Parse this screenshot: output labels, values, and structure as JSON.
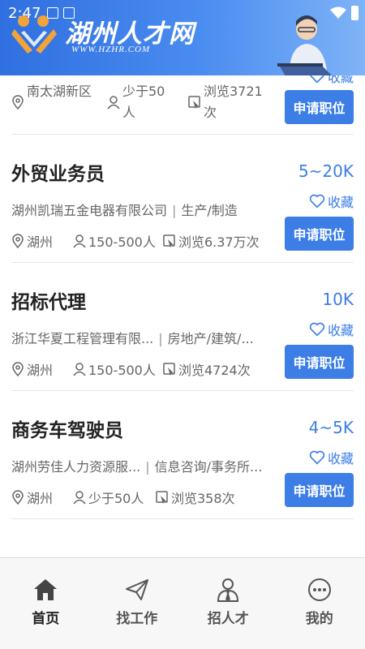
{
  "status_bar": {
    "time": "2:47"
  },
  "brand": {
    "title": "湖州人才网",
    "url": "WWW.HZHR.COM"
  },
  "jobs": [
    {
      "title": "",
      "salary": "",
      "favorite_label": "收藏",
      "company": "",
      "industry": "",
      "location": "南太湖新区",
      "company_size": "少于50人",
      "views": "浏览3721次",
      "apply_label": "申请职位"
    },
    {
      "title": "外贸业务员",
      "salary": "5~20K",
      "favorite_label": "收藏",
      "company": "湖州凯瑞五金电器有限公司",
      "industry": "生产/制造",
      "location": "湖州",
      "company_size": "150-500人",
      "views": "浏览6.37万次",
      "apply_label": "申请职位"
    },
    {
      "title": "招标代理",
      "salary": "10K",
      "favorite_label": "收藏",
      "company": "浙江华夏工程管理有限...",
      "industry": "房地产/建筑/...",
      "location": "湖州",
      "company_size": "150-500人",
      "views": "浏览4724次",
      "apply_label": "申请职位"
    },
    {
      "title": "商务车驾驶员",
      "salary": "4~5K",
      "favorite_label": "收藏",
      "company": "湖州劳佳人力资源服...",
      "industry": "信息咨询/事务所...",
      "location": "湖州",
      "company_size": "少于50人",
      "views": "浏览358次",
      "apply_label": "申请职位"
    }
  ],
  "nav": [
    {
      "label": "首页",
      "icon": "home-icon",
      "active": true
    },
    {
      "label": "找工作",
      "icon": "paper-plane-icon",
      "active": false
    },
    {
      "label": "招人才",
      "icon": "person-tie-icon",
      "active": false
    },
    {
      "label": "我的",
      "icon": "chat-dots-icon",
      "active": false
    }
  ],
  "colors": {
    "accent": "#3c7ee6",
    "header_start": "#2f6fe0",
    "header_end": "#7fb3f7"
  }
}
